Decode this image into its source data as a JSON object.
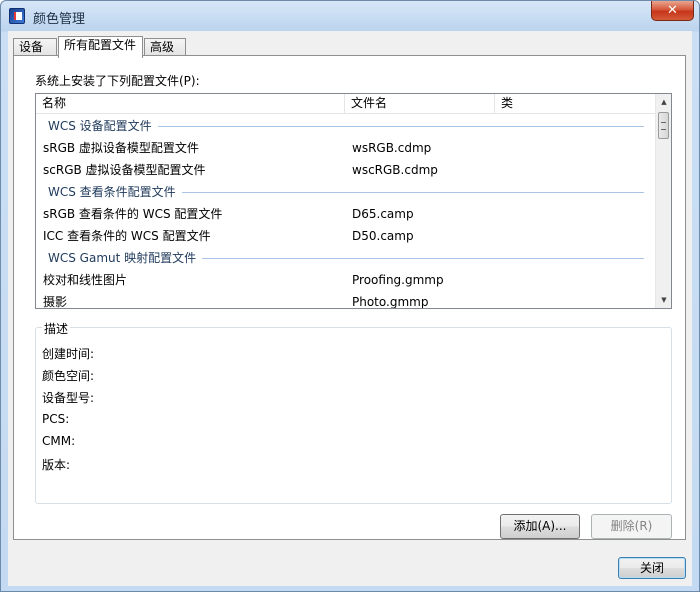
{
  "window": {
    "title": "颜色管理",
    "close_glyph": "✕"
  },
  "tabs": [
    {
      "label": "设备"
    },
    {
      "label": "所有配置文件"
    },
    {
      "label": "高级"
    }
  ],
  "installed_label": "系统上安装了下列配置文件(P):",
  "list": {
    "columns": [
      "名称",
      "文件名",
      "类"
    ],
    "groups": [
      {
        "title": "WCS 设备配置文件",
        "rows": [
          {
            "name": "sRGB 虚拟设备模型配置文件",
            "file": "wsRGB.cdmp"
          },
          {
            "name": "scRGB 虚拟设备模型配置文件",
            "file": "wscRGB.cdmp"
          }
        ]
      },
      {
        "title": "WCS 查看条件配置文件",
        "rows": [
          {
            "name": "sRGB 查看条件的 WCS 配置文件",
            "file": "D65.camp"
          },
          {
            "name": "ICC 查看条件的 WCS 配置文件",
            "file": "D50.camp"
          }
        ]
      },
      {
        "title": "WCS Gamut 映射配置文件",
        "rows": [
          {
            "name": "校对和线性图片",
            "file": "Proofing.gmmp"
          },
          {
            "name": "摄影",
            "file": "Photo.gmmp"
          }
        ]
      }
    ]
  },
  "description": {
    "legend": "描述",
    "fields": [
      "创建时间:",
      "颜色空间:",
      "设备型号:",
      "PCS:",
      "CMM:",
      "版本:"
    ]
  },
  "buttons": {
    "add": "添加(A)...",
    "delete": "删除(R)",
    "close": "关闭"
  },
  "scroll": {
    "up": "▲",
    "down": "▼"
  }
}
